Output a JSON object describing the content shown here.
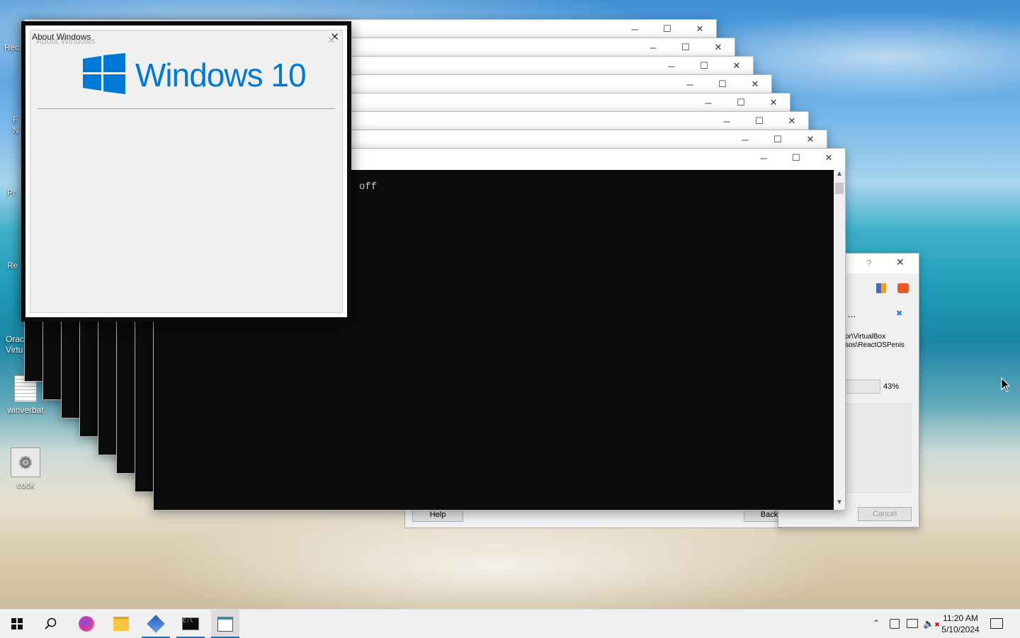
{
  "desktop": {
    "icons": [
      {
        "label": "winverbat"
      },
      {
        "label": "cock"
      }
    ],
    "fragments": [
      "Rec",
      "F",
      "N",
      "Pr",
      "Re",
      "Orac",
      "Virtu"
    ]
  },
  "about_window": {
    "title": "About Windows",
    "title_shadow": "About Windows",
    "logo_text": "Windows 10",
    "brand_color": "#0078d7"
  },
  "console_window": {
    "text": "off"
  },
  "installer_window": {
    "path_line1": "or\\VirtualBox",
    "path_line2": "sos\\ReactOSPenis",
    "ellipsis": "...",
    "progress": "43%",
    "help_button": "Help",
    "back_button": "Back",
    "cancel_button": "Cancel",
    "question": "?"
  },
  "taskbar": {
    "time": "11:20 AM",
    "date": "5/10/2024",
    "apps": [
      "start-icon",
      "search-icon",
      "firefox-icon",
      "file-explorer-icon",
      "virtualbox-icon",
      "cmd-icon",
      "winver-icon"
    ]
  }
}
